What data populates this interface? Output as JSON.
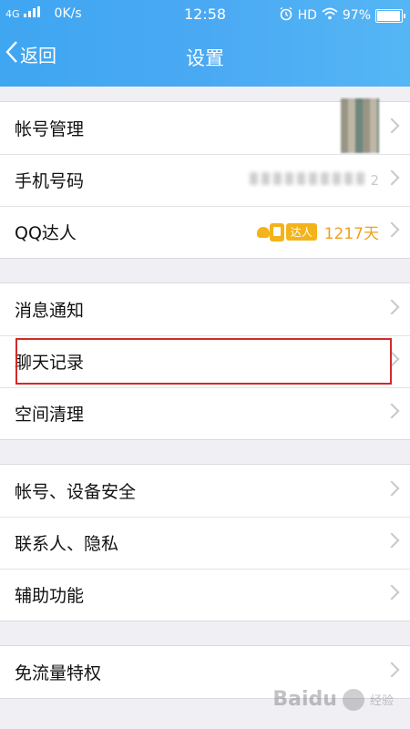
{
  "status": {
    "network": "4G",
    "speed": "0K/s",
    "time": "12:58",
    "hd": "HD",
    "battery_text": "97%",
    "battery_level": 0.97
  },
  "nav": {
    "back_label": "返回",
    "title": "设置"
  },
  "groups": [
    {
      "items": [
        {
          "label": "帐号管理"
        },
        {
          "label": "手机号码",
          "value_suffix": "2"
        },
        {
          "label": "QQ达人",
          "badge": "达人",
          "days": "1217天"
        }
      ]
    },
    {
      "items": [
        {
          "label": "消息通知"
        },
        {
          "label": "聊天记录"
        },
        {
          "label": "空间清理"
        }
      ]
    },
    {
      "items": [
        {
          "label": "帐号、设备安全"
        },
        {
          "label": "联系人、隐私"
        },
        {
          "label": "辅助功能"
        }
      ]
    },
    {
      "items": [
        {
          "label": "免流量特权"
        }
      ]
    }
  ],
  "watermark": {
    "brand": "Baidu",
    "sub": "经验"
  },
  "colors": {
    "accent": "#4aa9f3",
    "highlight": "#d22a2a",
    "qq_gold": "#f3b31a"
  }
}
